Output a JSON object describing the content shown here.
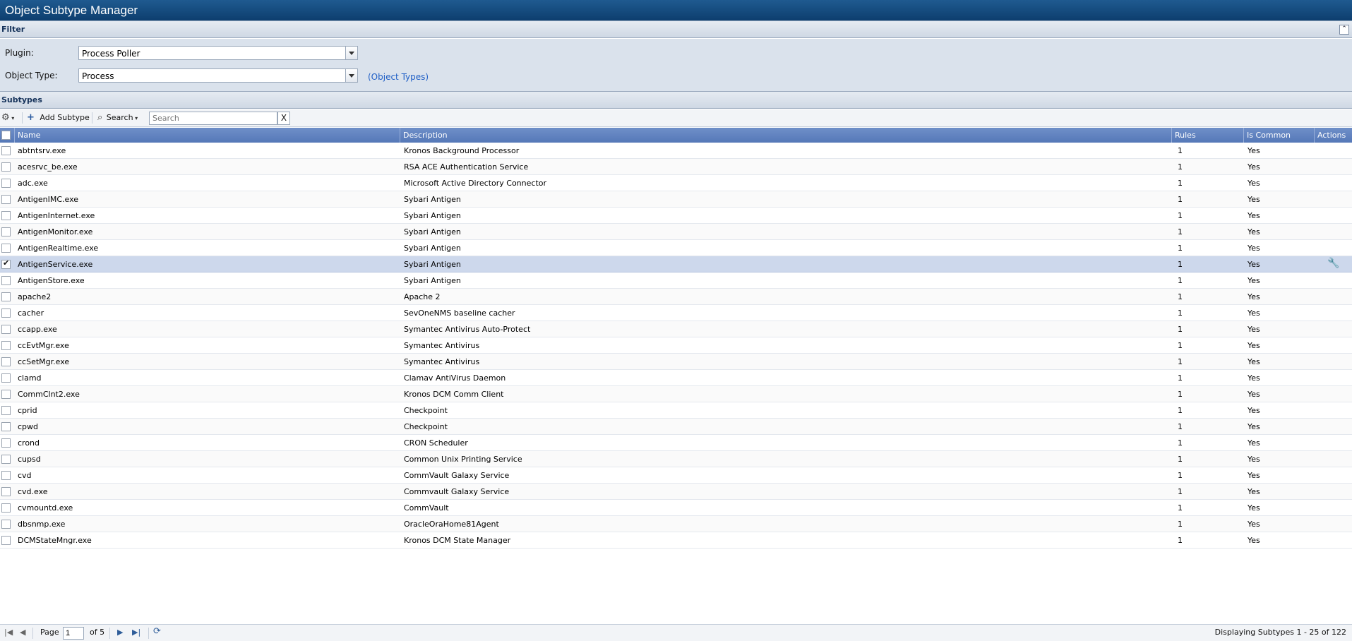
{
  "app": {
    "title": "Object Subtype Manager"
  },
  "filter": {
    "header": "Filter",
    "plugin_label": "Plugin:",
    "plugin_value": "Process Poller",
    "object_type_label": "Object Type:",
    "object_type_value": "Process",
    "object_types_link": "(Object Types)"
  },
  "subtypes": {
    "header": "Subtypes",
    "add_label": "Add Subtype",
    "search_label": "Search",
    "search_placeholder": "Search",
    "clear_label": "X"
  },
  "columns": {
    "name": "Name",
    "description": "Description",
    "rules": "Rules",
    "is_common": "Is Common",
    "actions": "Actions"
  },
  "rows": [
    {
      "name": "abtntsrv.exe",
      "description": "Kronos Background Processor",
      "rules": "1",
      "is_common": "Yes"
    },
    {
      "name": "acesrvc_be.exe",
      "description": "RSA ACE Authentication Service",
      "rules": "1",
      "is_common": "Yes"
    },
    {
      "name": "adc.exe",
      "description": "Microsoft Active Directory Connector",
      "rules": "1",
      "is_common": "Yes"
    },
    {
      "name": "AntigenIMC.exe",
      "description": "Sybari Antigen",
      "rules": "1",
      "is_common": "Yes"
    },
    {
      "name": "AntigenInternet.exe",
      "description": "Sybari Antigen",
      "rules": "1",
      "is_common": "Yes"
    },
    {
      "name": "AntigenMonitor.exe",
      "description": "Sybari Antigen",
      "rules": "1",
      "is_common": "Yes"
    },
    {
      "name": "AntigenRealtime.exe",
      "description": "Sybari Antigen",
      "rules": "1",
      "is_common": "Yes"
    },
    {
      "name": "AntigenService.exe",
      "description": "Sybari Antigen",
      "rules": "1",
      "is_common": "Yes",
      "selected": true
    },
    {
      "name": "AntigenStore.exe",
      "description": "Sybari Antigen",
      "rules": "1",
      "is_common": "Yes"
    },
    {
      "name": "apache2",
      "description": "Apache 2",
      "rules": "1",
      "is_common": "Yes"
    },
    {
      "name": "cacher",
      "description": "SevOneNMS baseline cacher",
      "rules": "1",
      "is_common": "Yes"
    },
    {
      "name": "ccapp.exe",
      "description": "Symantec Antivirus Auto-Protect",
      "rules": "1",
      "is_common": "Yes"
    },
    {
      "name": "ccEvtMgr.exe",
      "description": "Symantec Antivirus",
      "rules": "1",
      "is_common": "Yes"
    },
    {
      "name": "ccSetMgr.exe",
      "description": "Symantec Antivirus",
      "rules": "1",
      "is_common": "Yes"
    },
    {
      "name": "clamd",
      "description": "Clamav AntiVirus Daemon",
      "rules": "1",
      "is_common": "Yes"
    },
    {
      "name": "CommClnt2.exe",
      "description": "Kronos DCM Comm Client",
      "rules": "1",
      "is_common": "Yes"
    },
    {
      "name": "cprid",
      "description": "Checkpoint",
      "rules": "1",
      "is_common": "Yes"
    },
    {
      "name": "cpwd",
      "description": "Checkpoint",
      "rules": "1",
      "is_common": "Yes"
    },
    {
      "name": "crond",
      "description": "CRON Scheduler",
      "rules": "1",
      "is_common": "Yes"
    },
    {
      "name": "cupsd",
      "description": "Common Unix Printing Service",
      "rules": "1",
      "is_common": "Yes"
    },
    {
      "name": "cvd",
      "description": "CommVault Galaxy Service",
      "rules": "1",
      "is_common": "Yes"
    },
    {
      "name": "cvd.exe",
      "description": "Commvault Galaxy Service",
      "rules": "1",
      "is_common": "Yes"
    },
    {
      "name": "cvmountd.exe",
      "description": "CommVault",
      "rules": "1",
      "is_common": "Yes"
    },
    {
      "name": "dbsnmp.exe",
      "description": "OracleOraHome81Agent",
      "rules": "1",
      "is_common": "Yes"
    },
    {
      "name": "DCMStateMngr.exe",
      "description": "Kronos DCM State Manager",
      "rules": "1",
      "is_common": "Yes"
    }
  ],
  "pager": {
    "page_label": "Page",
    "page_value": "1",
    "of_label": "of 5",
    "display_text": "Displaying Subtypes 1 - 25 of 122"
  }
}
